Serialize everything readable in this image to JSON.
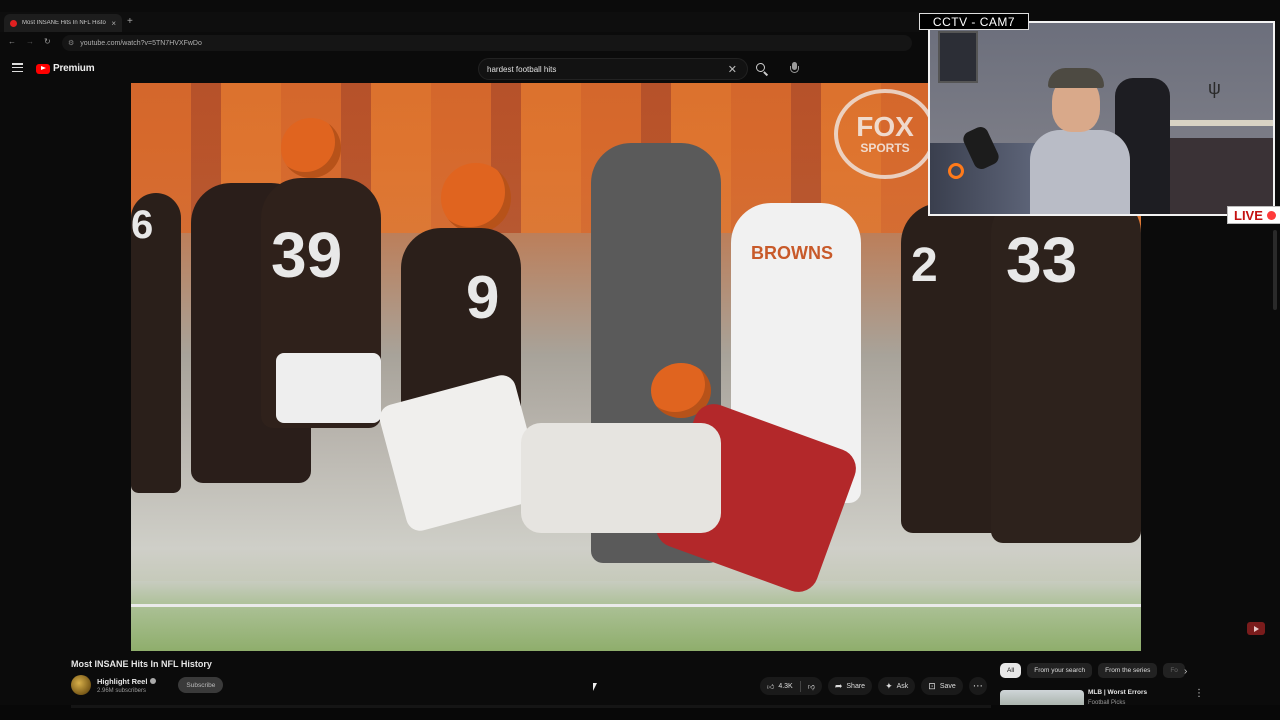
{
  "browser": {
    "tab_title": "Most INSANE Hits In NFL Histo",
    "tab_close": "×",
    "new_tab": "+",
    "url": "youtube.com/watch?v=5TN7HVXFwDo"
  },
  "header": {
    "brand": "Premium",
    "search_query": "hardest football hits",
    "clear_glyph": "✕"
  },
  "video": {
    "watermark_line1": "FOX",
    "watermark_line2": "SPORTS",
    "jersey_numbers": [
      "39",
      "9",
      "33",
      "2",
      "6"
    ],
    "sideline_text": "BROWNS"
  },
  "overlay": {
    "cam_label": "CCTV - CAM7",
    "live_label": "LIVE"
  },
  "below": {
    "title": "Most INSANE Hits In NFL History",
    "channel_name": "Highlight Reel",
    "subscribers": "2.96M subscribers",
    "subscribe_label": "Subscribe",
    "like_count": "4.3K",
    "share_label": "Share",
    "ask_label": "Ask",
    "save_label": "Save",
    "more_glyph": "⋯"
  },
  "chips": [
    "All",
    "From your search",
    "From the series",
    "Fo"
  ],
  "recommendation": {
    "title": "MLB | Worst Errors",
    "channel": "Football Picks"
  },
  "colors": {
    "youtube_red": "#ff0000",
    "live_red": "#c41010",
    "background": "#0b0b0b"
  },
  "icons": [
    "hamburger-menu-icon",
    "youtube-logo-icon",
    "search-icon",
    "mic-icon",
    "like-icon",
    "dislike-icon",
    "share-icon",
    "ask-sparkle-icon",
    "save-bookmark-icon",
    "youtube-mini-icon"
  ]
}
